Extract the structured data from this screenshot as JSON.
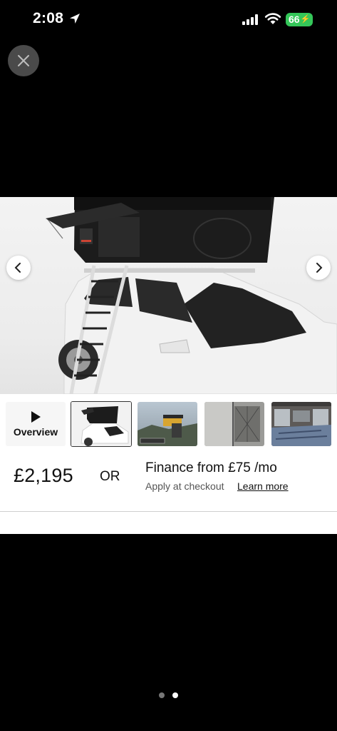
{
  "status_bar": {
    "time": "2:08",
    "battery": "66",
    "icons": [
      "location-arrow-icon",
      "cellular-signal-icon",
      "wifi-icon",
      "battery-charging-icon"
    ]
  },
  "viewer": {
    "close_icon": "close-icon",
    "prev_icon": "chevron-left-icon",
    "next_icon": "chevron-right-icon",
    "hero_image": "product-photo-roof-tent-on-white-car"
  },
  "thumbnails": {
    "overview_label": "Overview",
    "overview_icon": "play-icon",
    "selected_index": 1,
    "count": 5
  },
  "pricing": {
    "price": "£2,195",
    "or": "OR",
    "finance_title": "Finance from £75 /mo",
    "finance_subtitle": "Apply at checkout",
    "learn_more": "Learn more"
  },
  "pager": {
    "pages": 2,
    "active": 2,
    "active_color": "#ffffff",
    "inactive_color": "#777777"
  },
  "colors": {
    "battery": "#34c759",
    "background": "#000000",
    "card": "#ffffff"
  }
}
